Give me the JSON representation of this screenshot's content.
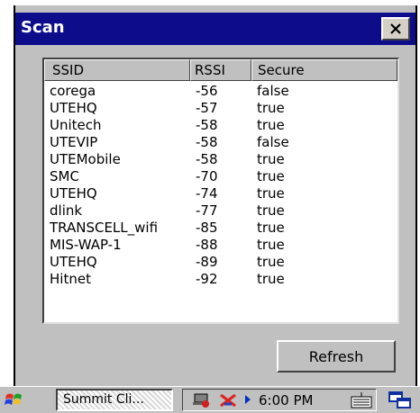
{
  "window": {
    "title": "Scan"
  },
  "table": {
    "columns": [
      "SSID",
      "RSSI",
      "Secure"
    ],
    "rows": [
      {
        "ssid": "corega",
        "rssi": "-56",
        "secure": "false"
      },
      {
        "ssid": "UTEHQ",
        "rssi": "-57",
        "secure": "true"
      },
      {
        "ssid": "Unitech",
        "rssi": "-58",
        "secure": "true"
      },
      {
        "ssid": "UTEVIP",
        "rssi": "-58",
        "secure": "false"
      },
      {
        "ssid": "UTEMobile",
        "rssi": "-58",
        "secure": "true"
      },
      {
        "ssid": "SMC",
        "rssi": "-70",
        "secure": "true"
      },
      {
        "ssid": "UTEHQ",
        "rssi": "-74",
        "secure": "true"
      },
      {
        "ssid": "dlink",
        "rssi": "-77",
        "secure": "true"
      },
      {
        "ssid": "TRANSCELL_wifi",
        "rssi": "-85",
        "secure": "true"
      },
      {
        "ssid": "MIS-WAP-1",
        "rssi": "-88",
        "secure": "true"
      },
      {
        "ssid": "UTEHQ",
        "rssi": "-89",
        "secure": "true"
      },
      {
        "ssid": "Hitnet",
        "rssi": "-92",
        "secure": "true"
      }
    ]
  },
  "buttons": {
    "refresh": "Refresh"
  },
  "taskbar": {
    "task": "Summit Cli...",
    "clock": "6:00 PM"
  },
  "icons": {
    "close": "close-icon",
    "start": "windows-start-icon",
    "network": "network-icon",
    "disconnected": "wireless-disconnected-icon",
    "arrow": "tray-arrow-icon",
    "keyboard": "keyboard-icon",
    "windows": "switch-windows-icon"
  },
  "colors": {
    "titlebar": "#0d0d8c",
    "chrome": "#c0c0c0"
  }
}
